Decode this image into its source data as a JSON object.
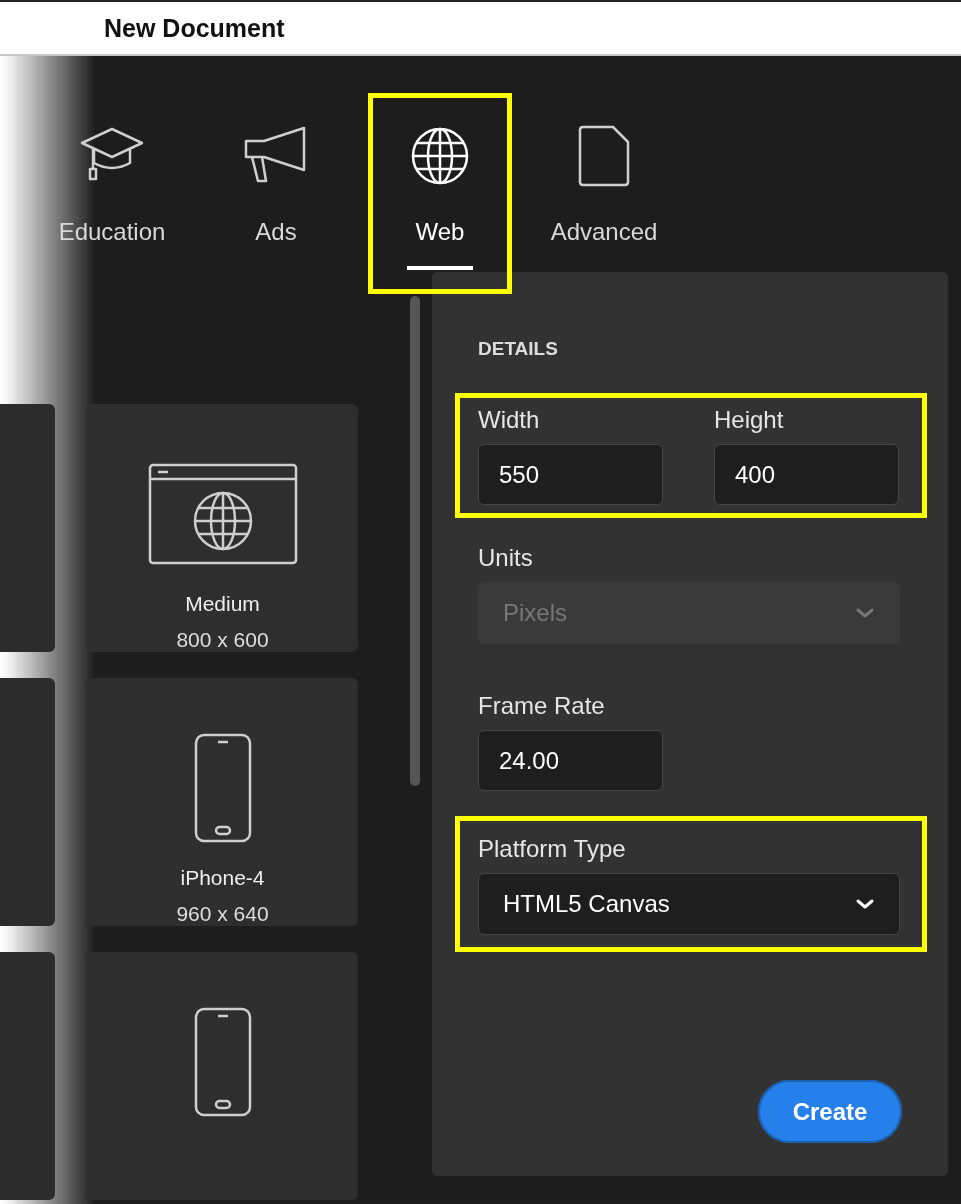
{
  "window": {
    "title": "New Document"
  },
  "tabs": [
    {
      "kind": "education",
      "label": "Education",
      "selected": false,
      "highlighted": false
    },
    {
      "kind": "ads",
      "label": "Ads",
      "selected": false,
      "highlighted": false
    },
    {
      "kind": "web",
      "label": "Web",
      "selected": true,
      "highlighted": true
    },
    {
      "kind": "advanced",
      "label": "Advanced",
      "selected": false,
      "highlighted": false
    }
  ],
  "presets": [
    {
      "kind": "browser",
      "name": "Medium",
      "size": "800 x 600"
    },
    {
      "kind": "phone",
      "name": "iPhone-4",
      "size": "960 x 640"
    },
    {
      "kind": "phone"
    }
  ],
  "details": {
    "heading": "DETAILS",
    "size_group": {
      "highlighted": true,
      "fields": [
        {
          "label": "Width",
          "value": "550"
        },
        {
          "label": "Height",
          "value": "400"
        }
      ]
    },
    "units": {
      "label": "Units",
      "value": "Pixels",
      "disabled": true
    },
    "frame_rate": {
      "label": "Frame Rate",
      "value": "24.00"
    },
    "platform": {
      "label": "Platform Type",
      "value": "HTML5 Canvas",
      "disabled": false,
      "highlighted": true
    },
    "create_button": "Create"
  }
}
